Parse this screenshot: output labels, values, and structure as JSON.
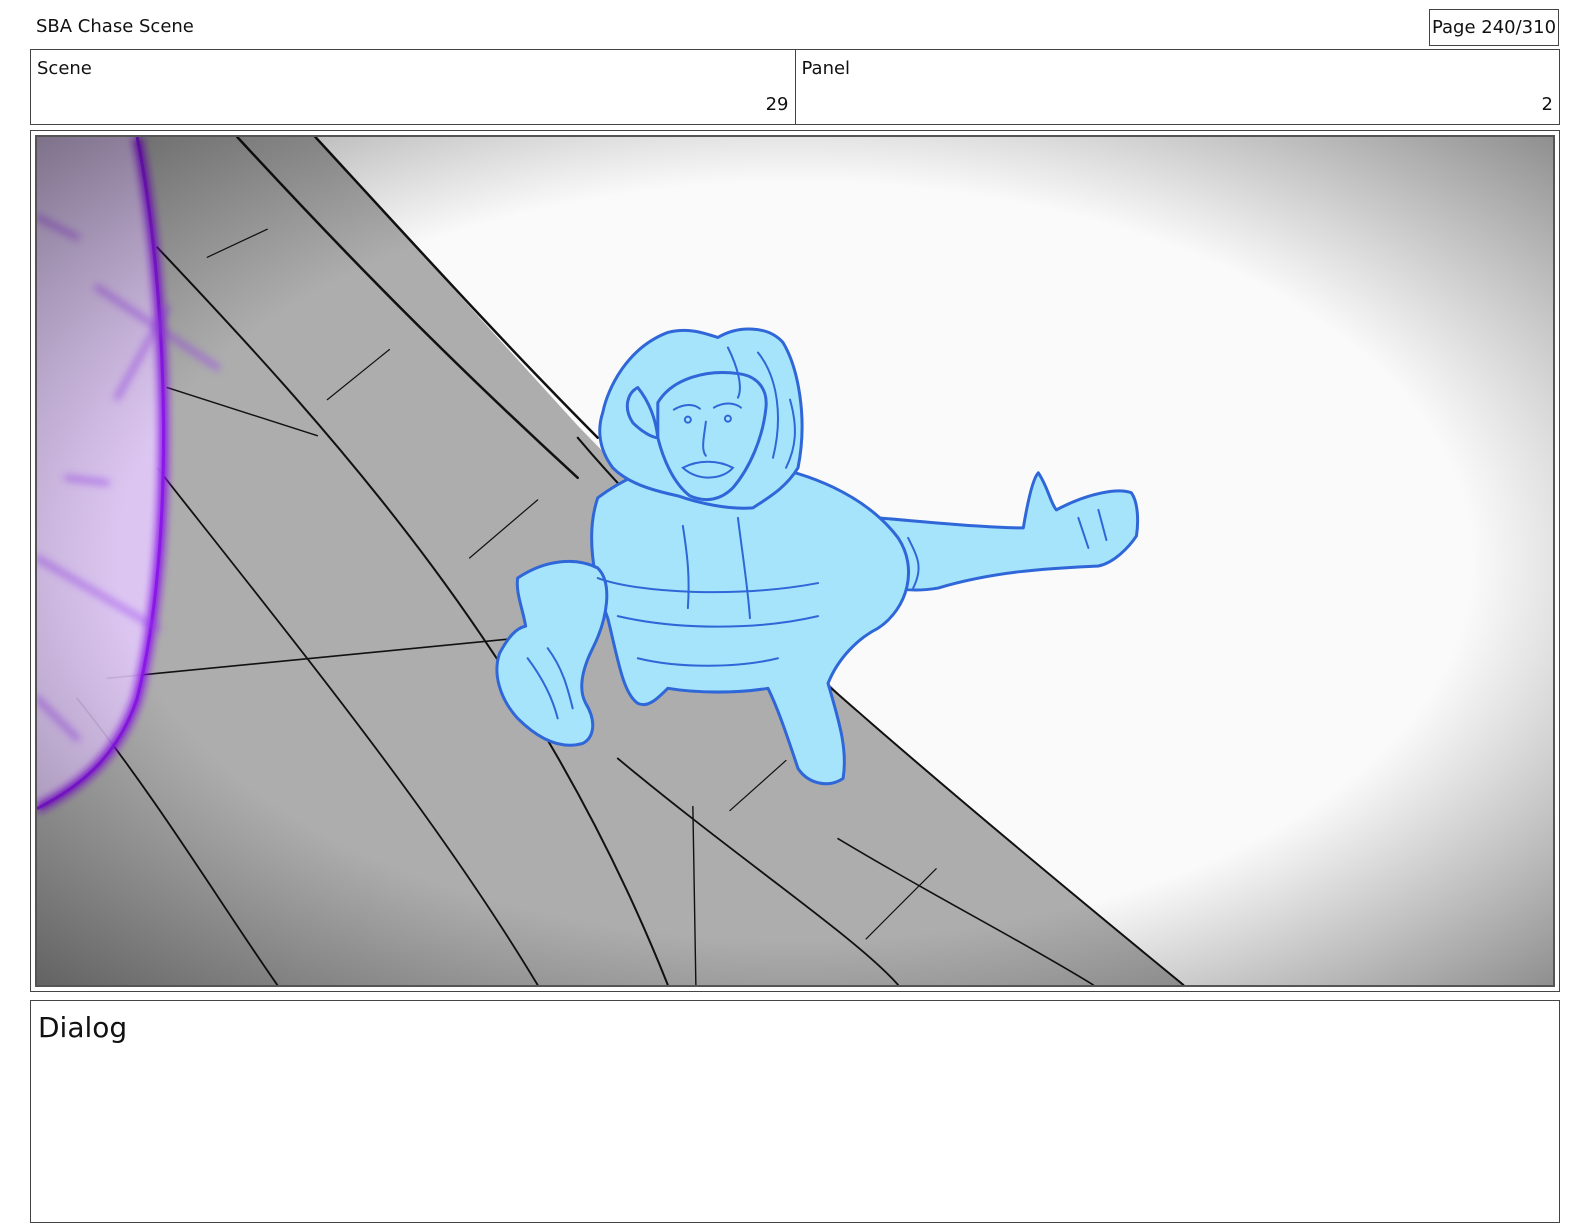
{
  "header": {
    "title": "SBA Chase Scene",
    "page": "Page 240/310"
  },
  "info": {
    "scene_label": "Scene",
    "scene_value": "29",
    "panel_label": "Panel",
    "panel_value": "2"
  },
  "frame": {
    "content": "storyboard-sketch",
    "colors": {
      "walkway": "#b0b0b0",
      "character_fill": "#a6e4fb",
      "character_line": "#2f67d8",
      "portal_fill": "#e3c9fb",
      "portal_line": "#8a18e8"
    }
  },
  "dialog": {
    "label": "Dialog"
  }
}
